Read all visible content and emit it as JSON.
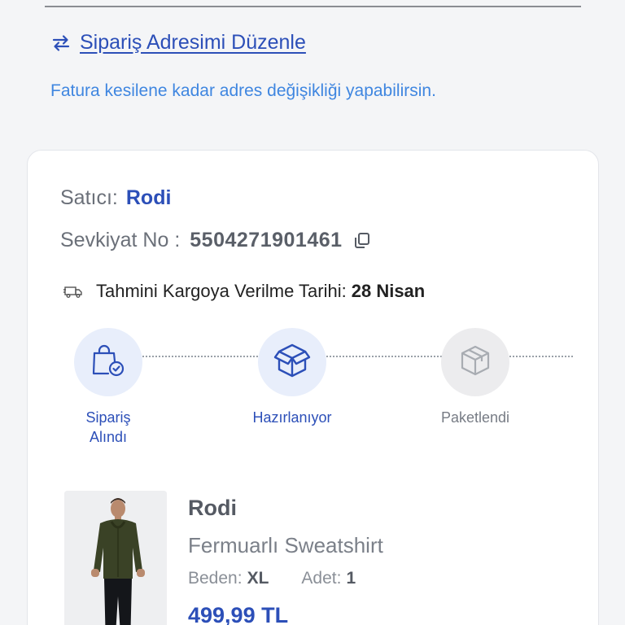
{
  "address": {
    "edit_label": "Sipariş Adresimi Düzenle",
    "note": "Fatura kesilene kadar adres değişikliği yapabilirsin."
  },
  "order": {
    "seller_label": "Satıcı:",
    "seller_name": "Rodi",
    "shipment_label": "Sevkiyat No :",
    "shipment_no": "5504271901461",
    "eta_label": "Tahmini Kargoya Verilme Tarihi:",
    "eta_value": "28 Nisan"
  },
  "steps": [
    {
      "label": "Sipariş Alındı",
      "icon": "shopping-bag-check-icon",
      "state": "done"
    },
    {
      "label": "Hazırlanıyor",
      "icon": "open-box-icon",
      "state": "current"
    },
    {
      "label": "Paketlendi",
      "icon": "box-icon",
      "state": "pending"
    }
  ],
  "product": {
    "brand": "Rodi",
    "name": "Fermuarlı Sweatshirt",
    "size_label": "Beden:",
    "size_value": "XL",
    "qty_label": "Adet:",
    "qty_value": "1",
    "price": "499,99 TL"
  },
  "colors": {
    "primary": "#2c4fb8",
    "note_blue": "#3f86e0",
    "step_active_bg": "#e8eefb",
    "step_inactive_bg": "#ececee"
  }
}
